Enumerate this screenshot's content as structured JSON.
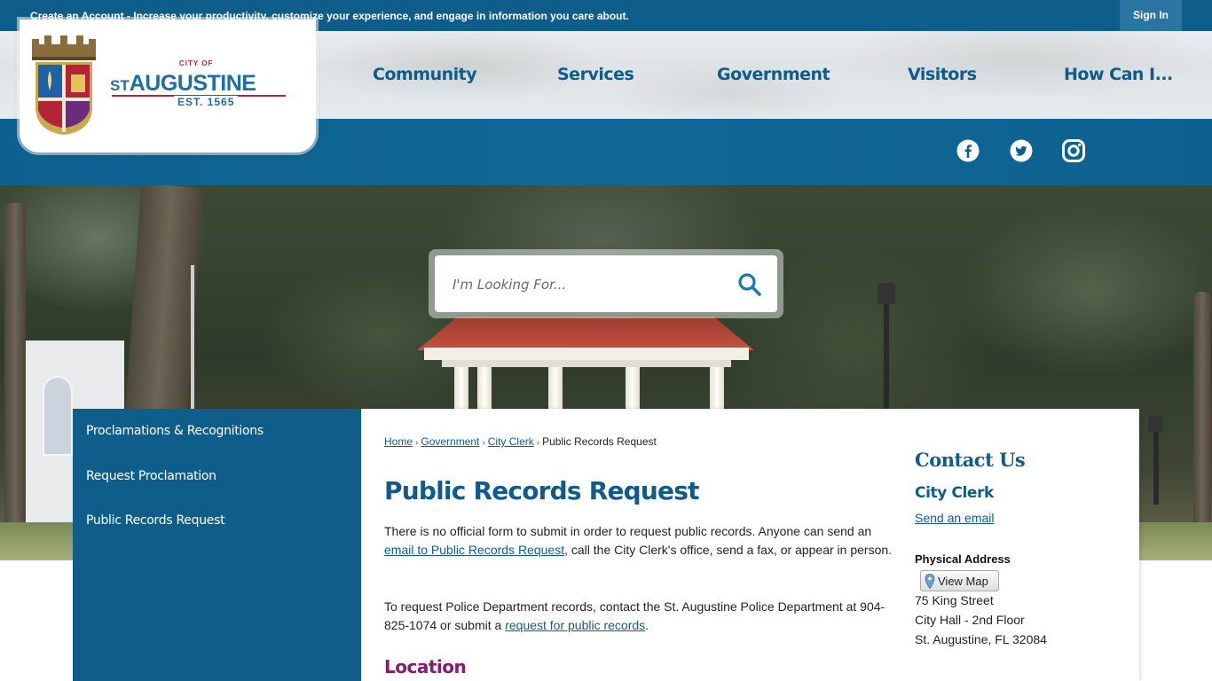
{
  "topbar": {
    "create_account_link": "Create an Account",
    "tagline": " - Increase your productivity, customize your experience, and engage in information you care about.",
    "sign_in": "Sign In"
  },
  "logo": {
    "city_of": "CITY OF",
    "name_prefix": "ST",
    "name_main": "AUGUSTINE",
    "established": "EST. 1565"
  },
  "nav": {
    "items": [
      "Community",
      "Services",
      "Government",
      "Visitors",
      "How Can I..."
    ]
  },
  "social": {
    "icons": [
      "facebook-icon",
      "twitter-icon",
      "instagram-icon"
    ]
  },
  "search": {
    "placeholder": "I'm Looking For..."
  },
  "sidebar": {
    "items": [
      {
        "label": "Proclamations & Recognitions"
      },
      {
        "label": "Request Proclamation"
      },
      {
        "label": "Public Records Request"
      }
    ]
  },
  "breadcrumb": {
    "home": "Home",
    "government": "Government",
    "city_clerk": "City Clerk",
    "current": "Public Records Request",
    "separator": "›"
  },
  "main": {
    "title": "Public Records Request",
    "p1_before": "There is no official form to submit in order to request public records. Anyone can send an ",
    "p1_link": "email to Public Records Request",
    "p1_after": ", call the City Clerk's office, send a fax, or appear in person.",
    "p2_before": "To request Police Department records, contact the St. Augustine Police Department at 904-825-1074 or submit a ",
    "p2_link": "request for public records",
    "p2_after": ".",
    "location_heading": "Location"
  },
  "contact": {
    "heading": "Contact Us",
    "department": "City Clerk",
    "email_link": "Send an email",
    "address_label": "Physical Address",
    "view_map": "View Map",
    "address_lines": [
      "75 King Street",
      "City Hall - 2nd Floor",
      "St. Augustine, FL 32084"
    ]
  },
  "colors": {
    "brand_blue": "#0e5d8a",
    "heading_blue": "#0f5c8a",
    "brand_red": "#b3243a",
    "location_purple": "#8a1a6e"
  }
}
